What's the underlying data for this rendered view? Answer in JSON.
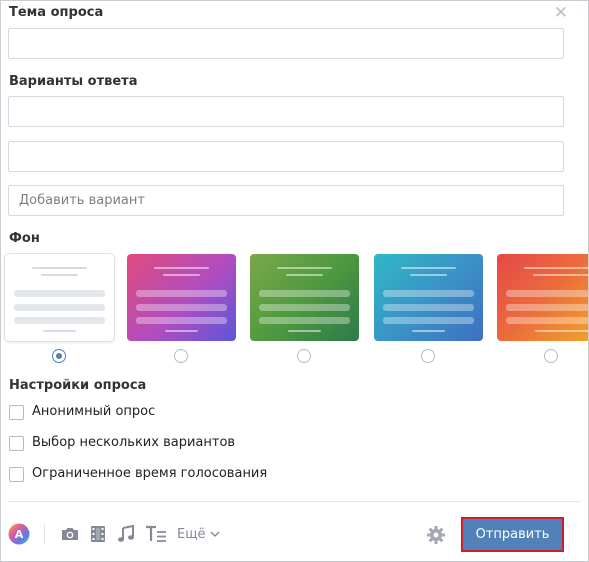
{
  "poll": {
    "topic_label": "Тема опроса",
    "topic_value": "",
    "answers_label": "Варианты ответа",
    "answers": [
      {
        "value": ""
      },
      {
        "value": ""
      }
    ],
    "add_option_placeholder": "Добавить вариант",
    "background_label": "Фон",
    "backgrounds": [
      {
        "name": "white",
        "selected": true
      },
      {
        "name": "pink-purple",
        "selected": false
      },
      {
        "name": "green",
        "selected": false
      },
      {
        "name": "teal-blue",
        "selected": false
      },
      {
        "name": "red-orange",
        "selected": false
      }
    ],
    "settings_label": "Настройки опроса",
    "settings": [
      {
        "label": "Анонимный опрос",
        "checked": false
      },
      {
        "label": "Выбор нескольких вариантов",
        "checked": false
      },
      {
        "label": "Ограниченное время голосования",
        "checked": false
      }
    ]
  },
  "toolbar": {
    "icons": [
      "avatar-icon",
      "camera-icon",
      "film-icon",
      "music-icon",
      "text-format-icon",
      "gear-icon"
    ],
    "more_label": "Ещё",
    "send_label": "Отправить"
  },
  "colors": {
    "accent": "#5181b8",
    "send_highlight_border": "#cc1f27",
    "icon_gray": "#828a99"
  }
}
